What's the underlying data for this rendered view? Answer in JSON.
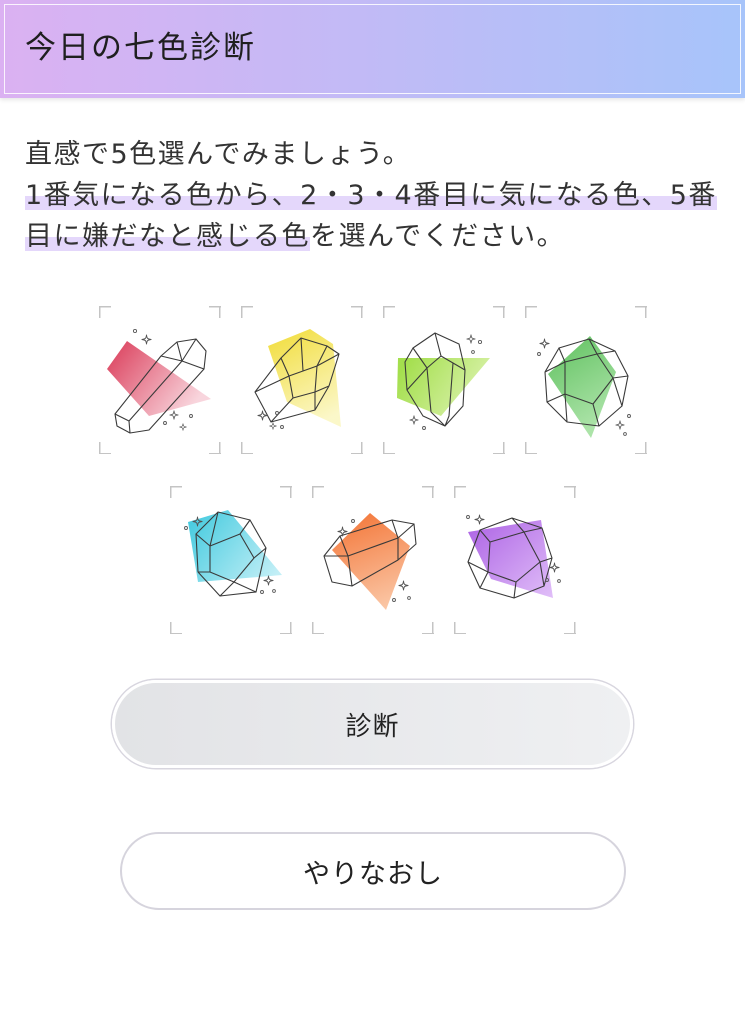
{
  "header": {
    "title": "今日の七色診断"
  },
  "instructions": {
    "lead": "直感で5色選んでみましょう。",
    "highlighted": "1番気になる色から、2・3・4番目に気になる色、5番目に嫌だなと感じる色",
    "rest": "を選んでください。"
  },
  "gems": [
    {
      "icon": "red-gem-icon",
      "gradient": [
        "#d8304f",
        "#f8d3db"
      ]
    },
    {
      "icon": "yellow-gem-icon",
      "gradient": [
        "#f1dc36",
        "#fbf7c6"
      ]
    },
    {
      "icon": "lime-gem-icon",
      "gradient": [
        "#9fdd44",
        "#ddf3b0"
      ]
    },
    {
      "icon": "green-gem-icon",
      "gradient": [
        "#56bd56",
        "#a8e2a4"
      ]
    },
    {
      "icon": "cyan-gem-icon",
      "gradient": [
        "#3fc9de",
        "#bfeef6"
      ]
    },
    {
      "icon": "orange-gem-icon",
      "gradient": [
        "#f37232",
        "#fac3a0"
      ]
    },
    {
      "icon": "purple-gem-icon",
      "gradient": [
        "#a85ae3",
        "#dfbbf8"
      ]
    }
  ],
  "buttons": {
    "diagnose": "診断",
    "reset": "やりなおし"
  },
  "theme": {
    "header_gradient": [
      "#dbb1f2",
      "#a7c4fa"
    ],
    "highlight": "#e4d7fb",
    "text": "#333333"
  }
}
